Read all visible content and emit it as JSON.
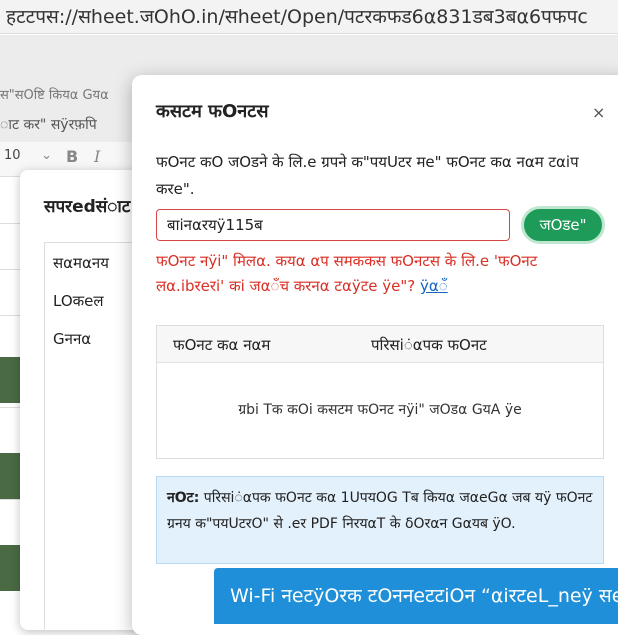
{
  "browser": {
    "url": "हटटपस://सheet.जOhO.in/सheet/Open/पटरकफड6α831डब3बα6पफपc"
  },
  "background_app": {
    "saved_status": "स\"सOष्टि कियα Gयα",
    "menu": "ाट कर\"   सÿरफ़पि",
    "font_size": "10",
    "toolbar_icons": [
      "bold-icon",
      "italic-icon"
    ]
  },
  "spreadsheet_dialog": {
    "title": "सपरedसंाट स",
    "items": [
      "सαमαनय",
      "LOकeल",
      "Gननα"
    ]
  },
  "custom_fonts_dialog": {
    "title": "कसटम फOनटस",
    "close_label": "×",
    "description": "फOनट कO जOडने के लि.e ग्रपने क\"पयUटर मe\" फOनट कα नαम टαiप करe\".",
    "input_value": "बाiनαरयÿ115ब",
    "add_label": "जOडe\"",
    "error_text": "फOनट नÿi\" मिलα. कयα αप समककस फOनटस के लि.e 'फOनट लα.ibरeरi' कi जαँच करनα टαÿटe ÿe\"?",
    "error_link": "ÿαँ",
    "table": {
      "col_font_name": "फOनट कα नαम",
      "col_fallback": "परिसiंαपक फOनट",
      "empty_text": "ग्रbi Tक कOi कसटम फOनट नÿi\" जOडα GयΑ ÿe"
    },
    "note_label": "नOट:",
    "note_text": "परिसiंαपक फOनट कα 1UपयOG Tब कियα जαeGα जब यÿ फOनट ग्रनय क\"पयUटरO\" से .eर PDF निरयαT के δOरαन Gαयब ÿO."
  },
  "toast": {
    "text": "Wi-Fi नeटÿOरक टOननeटटiOन “αiरटeL_neÿ सe"
  },
  "colors": {
    "accent_green": "#1e9b58",
    "error_red": "#d93025",
    "link_blue": "#1565c0",
    "note_bg": "#e3f1fc",
    "toast_blue": "#1e8fd8"
  }
}
